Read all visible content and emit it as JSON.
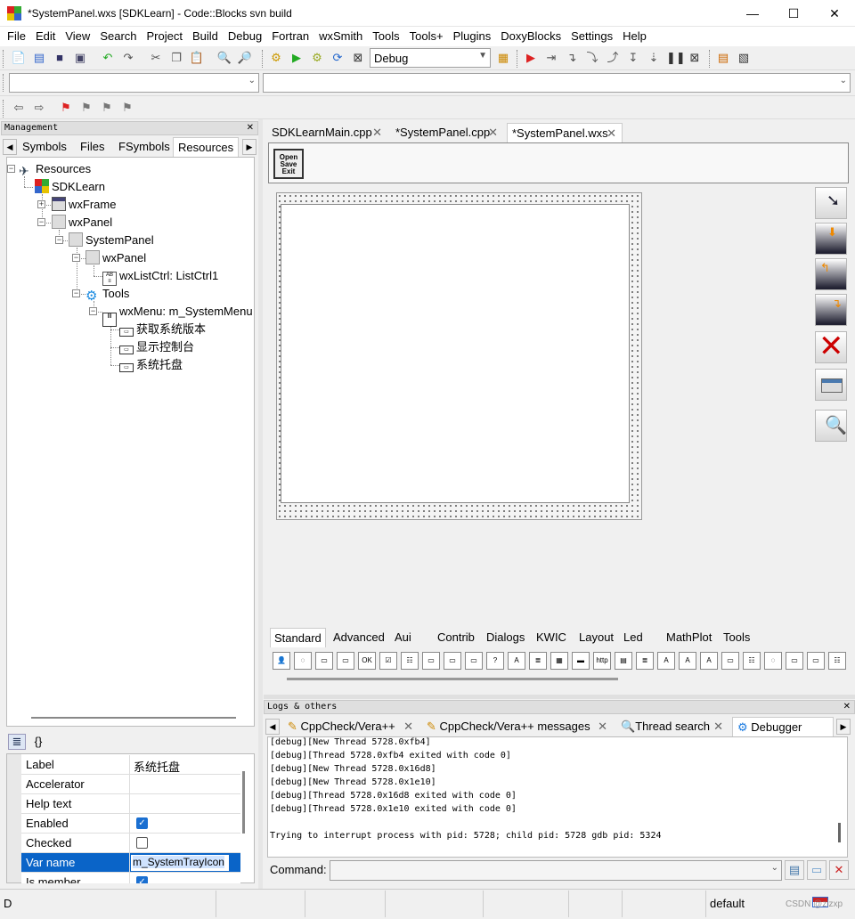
{
  "window": {
    "title": "*SystemPanel.wxs [SDKLearn] - Code::Blocks svn build",
    "minimize": "—",
    "maximize": "☐",
    "close": "✕"
  },
  "menu": [
    "File",
    "Edit",
    "View",
    "Search",
    "Project",
    "Build",
    "Debug",
    "Fortran",
    "wxSmith",
    "Tools",
    "Tools+",
    "Plugins",
    "DoxyBlocks",
    "Settings",
    "Help"
  ],
  "toolbar": {
    "build_target": "Debug"
  },
  "management": {
    "header": "Management",
    "tabs": [
      "Symbols",
      "Files",
      "FSymbols",
      "Resources"
    ],
    "tree": {
      "root": "Resources",
      "project": "SDKLearn",
      "wxframe": "wxFrame",
      "wxpanel": "wxPanel",
      "systempanel": "SystemPanel",
      "inner_panel": "wxPanel",
      "listctrl": "wxListCtrl: ListCtrl1",
      "tools": "Tools",
      "menu": "wxMenu: m_SystemMenu",
      "menu_items": [
        "获取系统版本",
        "显示控制台",
        "系统托盘"
      ]
    }
  },
  "properties": {
    "tab_props": "≣",
    "tab_events": "{}",
    "rows": [
      {
        "key": "Label",
        "value": "系统托盘"
      },
      {
        "key": "Accelerator",
        "value": ""
      },
      {
        "key": "Help text",
        "value": ""
      },
      {
        "key": "Enabled",
        "value": "checked"
      },
      {
        "key": "Checked",
        "value": "unchecked"
      },
      {
        "key": "Var name",
        "value": "m_SystemTrayIcon"
      },
      {
        "key": "Is member",
        "value": "checked"
      }
    ]
  },
  "editor": {
    "tabs": [
      "SDKLearnMain.cpp",
      "*SystemPanel.cpp",
      "*SystemPanel.wxs"
    ],
    "tab_close": "✕",
    "preview_icon_text": "Open Save Exit"
  },
  "palette": {
    "tabs": [
      "Standard",
      "Advanced",
      "Aui",
      "Contrib",
      "Dialogs",
      "KWIC",
      "Layout",
      "Led",
      "MathPlot",
      "Tools"
    ]
  },
  "logs": {
    "header": "Logs & others",
    "tabs": [
      "CppCheck/Vera++",
      "CppCheck/Vera++ messages",
      "Thread search",
      "Debugger"
    ],
    "lines": [
      "[debug][New Thread 5728.0xfb4]",
      "[debug][Thread 5728.0xfb4 exited with code 0]",
      "[debug][New Thread 5728.0x16d8]",
      "[debug][New Thread 5728.0x1e10]",
      "[debug][Thread 5728.0x16d8 exited with code 0]",
      "[debug][Thread 5728.0x1e10 exited with code 0]",
      "",
      "Trying to interrupt process with pid: 5728; child pid: 5728 gdb pid: 5324"
    ],
    "command_label": "Command:"
  },
  "statusbar": {
    "left": "D",
    "mode": "default",
    "watermark": "CSDN @zlzxp"
  }
}
